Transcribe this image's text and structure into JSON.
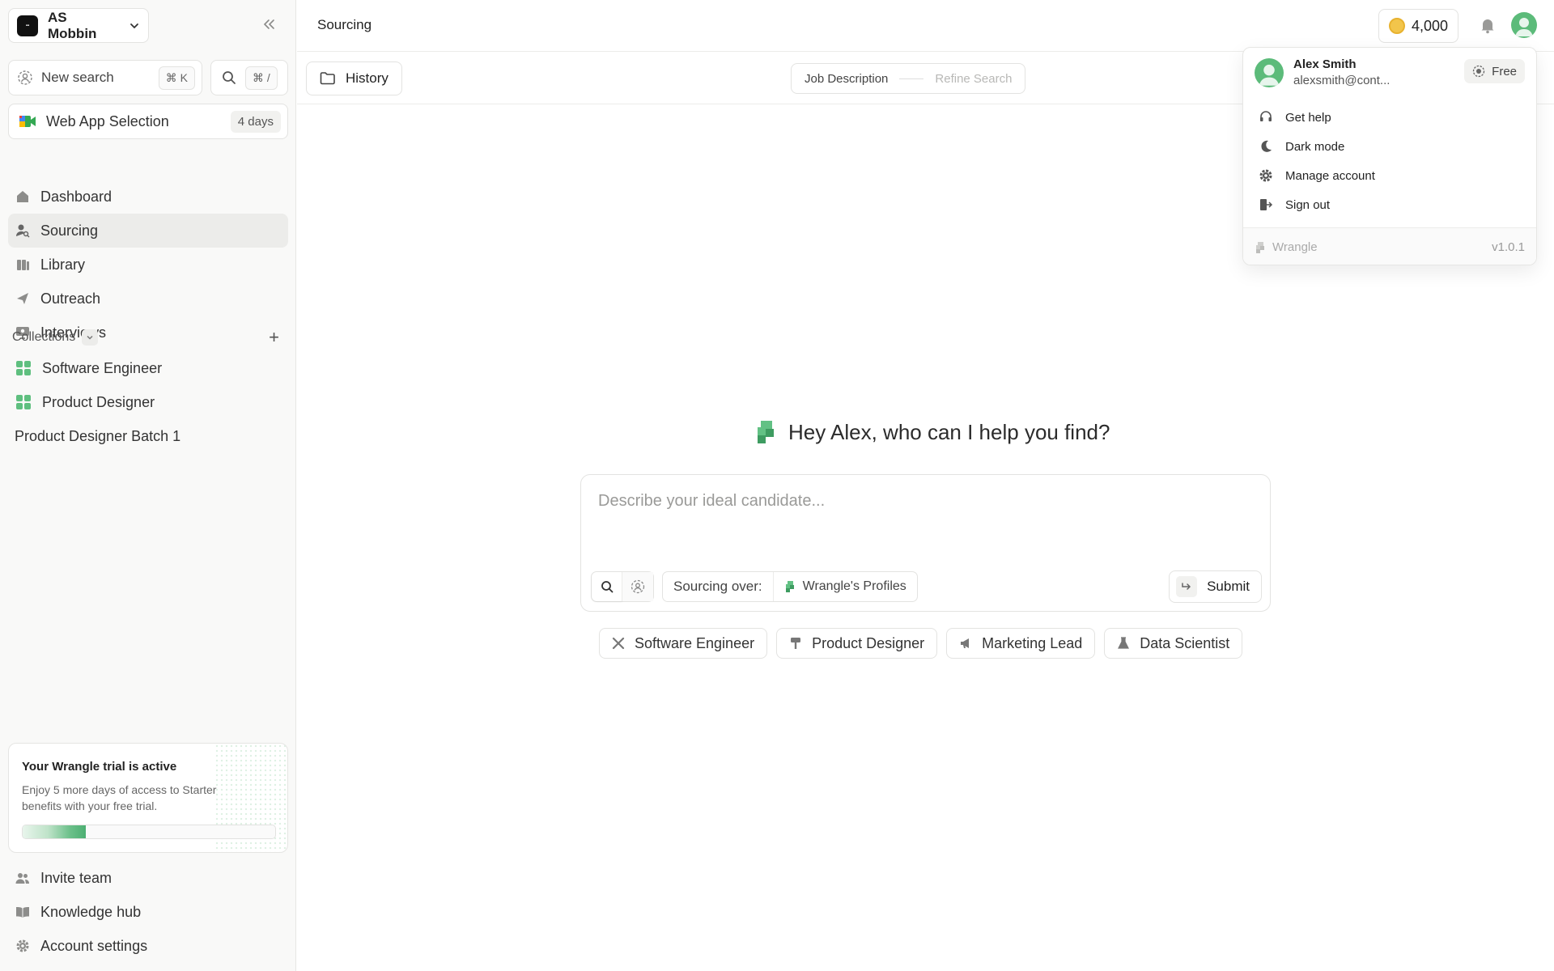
{
  "workspace": {
    "name": "AS Mobbin"
  },
  "sidebar": {
    "new_search": {
      "label": "New search",
      "shortcut": "⌘ K"
    },
    "search_shortcut": "⌘ /",
    "meeting": {
      "label": "Web App Selection",
      "days": "4 days"
    },
    "nav": [
      {
        "label": "Dashboard",
        "icon": "dashboard-icon"
      },
      {
        "label": "Sourcing",
        "icon": "sourcing-icon",
        "active": true
      },
      {
        "label": "Library",
        "icon": "library-icon"
      },
      {
        "label": "Outreach",
        "icon": "outreach-icon"
      },
      {
        "label": "Interviews",
        "icon": "interviews-icon"
      }
    ],
    "collections": {
      "label": "Collections",
      "items": [
        "Software Engineer",
        "Product Designer"
      ],
      "plain_item": "Product Designer Batch 1"
    },
    "trial": {
      "title": "Your Wrangle trial is active",
      "body": "Enjoy 5 more days of access to Starter benefits with your free trial.",
      "progress": 0.25
    },
    "bottom": [
      {
        "label": "Invite team",
        "icon": "invite-team-icon"
      },
      {
        "label": "Knowledge hub",
        "icon": "knowledge-hub-icon"
      },
      {
        "label": "Account settings",
        "icon": "settings-icon"
      }
    ]
  },
  "header": {
    "title": "Sourcing",
    "credits": "4,000"
  },
  "subbar": {
    "history": "History",
    "steps": [
      "Job Description",
      "Refine Search"
    ]
  },
  "main": {
    "greeting": "Hey Alex, who can I help you find?",
    "placeholder": "Describe your ideal candidate...",
    "sourcing_label": "Sourcing over:",
    "sourcing_value": "Wrangle's Profiles",
    "submit": "Submit",
    "chips": [
      {
        "label": "Software Engineer",
        "icon": "tools-icon"
      },
      {
        "label": "Product Designer",
        "icon": "brush-icon"
      },
      {
        "label": "Marketing Lead",
        "icon": "megaphone-icon"
      },
      {
        "label": "Data Scientist",
        "icon": "flask-icon"
      }
    ]
  },
  "user_menu": {
    "name": "Alex Smith",
    "email": "alexsmith@cont...",
    "plan": "Free",
    "items": [
      {
        "label": "Get help",
        "icon": "headset-icon"
      },
      {
        "label": "Dark mode",
        "icon": "moon-icon"
      },
      {
        "label": "Manage account",
        "icon": "gear-icon"
      },
      {
        "label": "Sign out",
        "icon": "sign-out-icon"
      }
    ],
    "brand": "Wrangle",
    "version": "v1.0.1"
  },
  "colors": {
    "accent": "#5cbb7a",
    "coin": "#f2c54b"
  }
}
